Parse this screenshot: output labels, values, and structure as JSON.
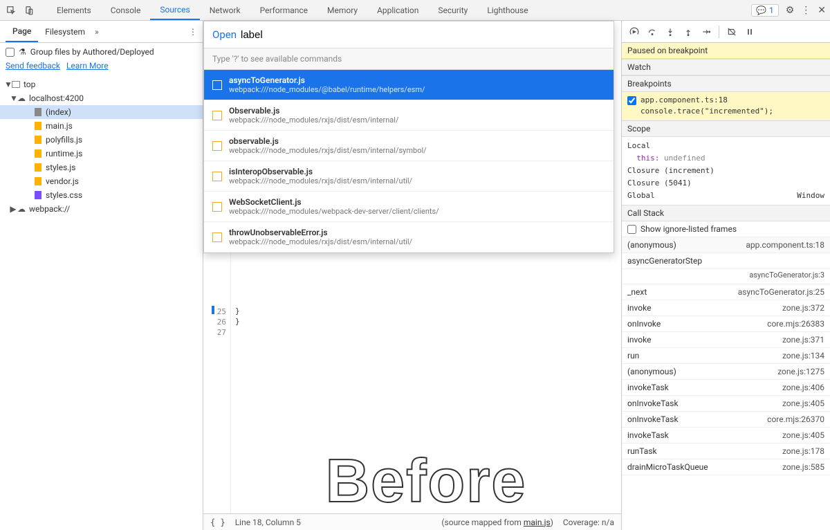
{
  "toolbar": {
    "tabs": [
      "Elements",
      "Console",
      "Sources",
      "Network",
      "Performance",
      "Memory",
      "Application",
      "Security",
      "Lighthouse"
    ],
    "active_tab": "Sources",
    "issues_count": "1"
  },
  "left": {
    "subtabs": [
      "Page",
      "Filesystem"
    ],
    "active_subtab": "Page",
    "group_label": "Group files by Authored/Deployed",
    "feedback_link": "Send feedback",
    "learn_link": "Learn More",
    "tree": {
      "top": "top",
      "host": "localhost:4200",
      "files": [
        "(index)",
        "main.js",
        "polyfills.js",
        "runtime.js",
        "styles.js",
        "vendor.js",
        "styles.css"
      ],
      "webpack": "webpack://"
    }
  },
  "quickopen": {
    "open_label": "Open",
    "input_value": "label",
    "hint": "Type '?' to see available commands",
    "items": [
      {
        "title": "asyncToGenerator.js",
        "path": "webpack:///node_modules/@babel/runtime/helpers/esm/"
      },
      {
        "title": "Observable.js",
        "path": "webpack:///node_modules/rxjs/dist/esm/internal/"
      },
      {
        "title": "observable.js",
        "path": "webpack:///node_modules/rxjs/dist/esm/internal/symbol/"
      },
      {
        "title": "isInteropObservable.js",
        "path": "webpack:///node_modules/rxjs/dist/esm/internal/util/"
      },
      {
        "title": "WebSocketClient.js",
        "path": "webpack:///node_modules/webpack-dev-server/client/clients/"
      },
      {
        "title": "throwUnobservableError.js",
        "path": "webpack:///node_modules/rxjs/dist/esm/internal/util/"
      }
    ]
  },
  "editor": {
    "lines": [
      "25",
      "26",
      "27"
    ],
    "code": [
      "  }",
      "}",
      ""
    ],
    "watermark": "Before",
    "status": {
      "line_col": "Line 18, Column 5",
      "sourcemap_pre": "(source mapped from ",
      "sourcemap_file": "main.js",
      "sourcemap_post": ")",
      "coverage": "Coverage: n/a"
    }
  },
  "right": {
    "paused": "Paused on breakpoint",
    "watch": "Watch",
    "breakpoints": "Breakpoints",
    "bp_item_file": "app.component.ts:18",
    "bp_item_code": "console.trace(\"incremented\");",
    "scope": "Scope",
    "scope_local": "Local",
    "scope_this": "this:",
    "scope_undef": "undefined",
    "scope_closure1": "Closure (increment)",
    "scope_closure2": "Closure (5041)",
    "scope_global": "Global",
    "scope_window": "Window",
    "callstack": "Call Stack",
    "show_ignore": "Show ignore-listed frames",
    "frames": [
      {
        "fn": "(anonymous)",
        "loc": "app.component.ts:18",
        "sub": ""
      },
      {
        "fn": "asyncGeneratorStep",
        "loc": "",
        "sub": "asyncToGenerator.js:3"
      },
      {
        "fn": "_next",
        "loc": "asyncToGenerator.js:25",
        "sub": ""
      },
      {
        "fn": "invoke",
        "loc": "zone.js:372",
        "sub": ""
      },
      {
        "fn": "onInvoke",
        "loc": "core.mjs:26383",
        "sub": ""
      },
      {
        "fn": "invoke",
        "loc": "zone.js:371",
        "sub": ""
      },
      {
        "fn": "run",
        "loc": "zone.js:134",
        "sub": ""
      },
      {
        "fn": "(anonymous)",
        "loc": "zone.js:1275",
        "sub": ""
      },
      {
        "fn": "invokeTask",
        "loc": "zone.js:406",
        "sub": ""
      },
      {
        "fn": "onInvokeTask",
        "loc": "zone.js:405",
        "sub": ""
      },
      {
        "fn": "onInvokeTask",
        "loc": "core.mjs:26370",
        "sub": ""
      },
      {
        "fn": "invokeTask",
        "loc": "zone.js:405",
        "sub": ""
      },
      {
        "fn": "runTask",
        "loc": "zone.js:178",
        "sub": ""
      },
      {
        "fn": "drainMicroTaskQueue",
        "loc": "zone.js:585",
        "sub": ""
      }
    ]
  }
}
